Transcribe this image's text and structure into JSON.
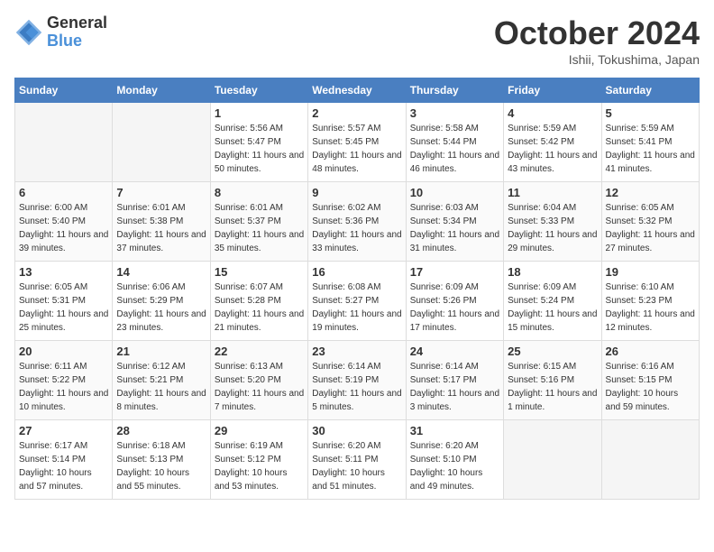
{
  "logo": {
    "general": "General",
    "blue": "Blue"
  },
  "title": "October 2024",
  "location": "Ishii, Tokushima, Japan",
  "days_of_week": [
    "Sunday",
    "Monday",
    "Tuesday",
    "Wednesday",
    "Thursday",
    "Friday",
    "Saturday"
  ],
  "weeks": [
    [
      {
        "day": "",
        "sunrise": "",
        "sunset": "",
        "daylight": ""
      },
      {
        "day": "",
        "sunrise": "",
        "sunset": "",
        "daylight": ""
      },
      {
        "day": "1",
        "sunrise": "Sunrise: 5:56 AM",
        "sunset": "Sunset: 5:47 PM",
        "daylight": "Daylight: 11 hours and 50 minutes."
      },
      {
        "day": "2",
        "sunrise": "Sunrise: 5:57 AM",
        "sunset": "Sunset: 5:45 PM",
        "daylight": "Daylight: 11 hours and 48 minutes."
      },
      {
        "day": "3",
        "sunrise": "Sunrise: 5:58 AM",
        "sunset": "Sunset: 5:44 PM",
        "daylight": "Daylight: 11 hours and 46 minutes."
      },
      {
        "day": "4",
        "sunrise": "Sunrise: 5:59 AM",
        "sunset": "Sunset: 5:42 PM",
        "daylight": "Daylight: 11 hours and 43 minutes."
      },
      {
        "day": "5",
        "sunrise": "Sunrise: 5:59 AM",
        "sunset": "Sunset: 5:41 PM",
        "daylight": "Daylight: 11 hours and 41 minutes."
      }
    ],
    [
      {
        "day": "6",
        "sunrise": "Sunrise: 6:00 AM",
        "sunset": "Sunset: 5:40 PM",
        "daylight": "Daylight: 11 hours and 39 minutes."
      },
      {
        "day": "7",
        "sunrise": "Sunrise: 6:01 AM",
        "sunset": "Sunset: 5:38 PM",
        "daylight": "Daylight: 11 hours and 37 minutes."
      },
      {
        "day": "8",
        "sunrise": "Sunrise: 6:01 AM",
        "sunset": "Sunset: 5:37 PM",
        "daylight": "Daylight: 11 hours and 35 minutes."
      },
      {
        "day": "9",
        "sunrise": "Sunrise: 6:02 AM",
        "sunset": "Sunset: 5:36 PM",
        "daylight": "Daylight: 11 hours and 33 minutes."
      },
      {
        "day": "10",
        "sunrise": "Sunrise: 6:03 AM",
        "sunset": "Sunset: 5:34 PM",
        "daylight": "Daylight: 11 hours and 31 minutes."
      },
      {
        "day": "11",
        "sunrise": "Sunrise: 6:04 AM",
        "sunset": "Sunset: 5:33 PM",
        "daylight": "Daylight: 11 hours and 29 minutes."
      },
      {
        "day": "12",
        "sunrise": "Sunrise: 6:05 AM",
        "sunset": "Sunset: 5:32 PM",
        "daylight": "Daylight: 11 hours and 27 minutes."
      }
    ],
    [
      {
        "day": "13",
        "sunrise": "Sunrise: 6:05 AM",
        "sunset": "Sunset: 5:31 PM",
        "daylight": "Daylight: 11 hours and 25 minutes."
      },
      {
        "day": "14",
        "sunrise": "Sunrise: 6:06 AM",
        "sunset": "Sunset: 5:29 PM",
        "daylight": "Daylight: 11 hours and 23 minutes."
      },
      {
        "day": "15",
        "sunrise": "Sunrise: 6:07 AM",
        "sunset": "Sunset: 5:28 PM",
        "daylight": "Daylight: 11 hours and 21 minutes."
      },
      {
        "day": "16",
        "sunrise": "Sunrise: 6:08 AM",
        "sunset": "Sunset: 5:27 PM",
        "daylight": "Daylight: 11 hours and 19 minutes."
      },
      {
        "day": "17",
        "sunrise": "Sunrise: 6:09 AM",
        "sunset": "Sunset: 5:26 PM",
        "daylight": "Daylight: 11 hours and 17 minutes."
      },
      {
        "day": "18",
        "sunrise": "Sunrise: 6:09 AM",
        "sunset": "Sunset: 5:24 PM",
        "daylight": "Daylight: 11 hours and 15 minutes."
      },
      {
        "day": "19",
        "sunrise": "Sunrise: 6:10 AM",
        "sunset": "Sunset: 5:23 PM",
        "daylight": "Daylight: 11 hours and 12 minutes."
      }
    ],
    [
      {
        "day": "20",
        "sunrise": "Sunrise: 6:11 AM",
        "sunset": "Sunset: 5:22 PM",
        "daylight": "Daylight: 11 hours and 10 minutes."
      },
      {
        "day": "21",
        "sunrise": "Sunrise: 6:12 AM",
        "sunset": "Sunset: 5:21 PM",
        "daylight": "Daylight: 11 hours and 8 minutes."
      },
      {
        "day": "22",
        "sunrise": "Sunrise: 6:13 AM",
        "sunset": "Sunset: 5:20 PM",
        "daylight": "Daylight: 11 hours and 7 minutes."
      },
      {
        "day": "23",
        "sunrise": "Sunrise: 6:14 AM",
        "sunset": "Sunset: 5:19 PM",
        "daylight": "Daylight: 11 hours and 5 minutes."
      },
      {
        "day": "24",
        "sunrise": "Sunrise: 6:14 AM",
        "sunset": "Sunset: 5:17 PM",
        "daylight": "Daylight: 11 hours and 3 minutes."
      },
      {
        "day": "25",
        "sunrise": "Sunrise: 6:15 AM",
        "sunset": "Sunset: 5:16 PM",
        "daylight": "Daylight: 11 hours and 1 minute."
      },
      {
        "day": "26",
        "sunrise": "Sunrise: 6:16 AM",
        "sunset": "Sunset: 5:15 PM",
        "daylight": "Daylight: 10 hours and 59 minutes."
      }
    ],
    [
      {
        "day": "27",
        "sunrise": "Sunrise: 6:17 AM",
        "sunset": "Sunset: 5:14 PM",
        "daylight": "Daylight: 10 hours and 57 minutes."
      },
      {
        "day": "28",
        "sunrise": "Sunrise: 6:18 AM",
        "sunset": "Sunset: 5:13 PM",
        "daylight": "Daylight: 10 hours and 55 minutes."
      },
      {
        "day": "29",
        "sunrise": "Sunrise: 6:19 AM",
        "sunset": "Sunset: 5:12 PM",
        "daylight": "Daylight: 10 hours and 53 minutes."
      },
      {
        "day": "30",
        "sunrise": "Sunrise: 6:20 AM",
        "sunset": "Sunset: 5:11 PM",
        "daylight": "Daylight: 10 hours and 51 minutes."
      },
      {
        "day": "31",
        "sunrise": "Sunrise: 6:20 AM",
        "sunset": "Sunset: 5:10 PM",
        "daylight": "Daylight: 10 hours and 49 minutes."
      },
      {
        "day": "",
        "sunrise": "",
        "sunset": "",
        "daylight": ""
      },
      {
        "day": "",
        "sunrise": "",
        "sunset": "",
        "daylight": ""
      }
    ]
  ]
}
